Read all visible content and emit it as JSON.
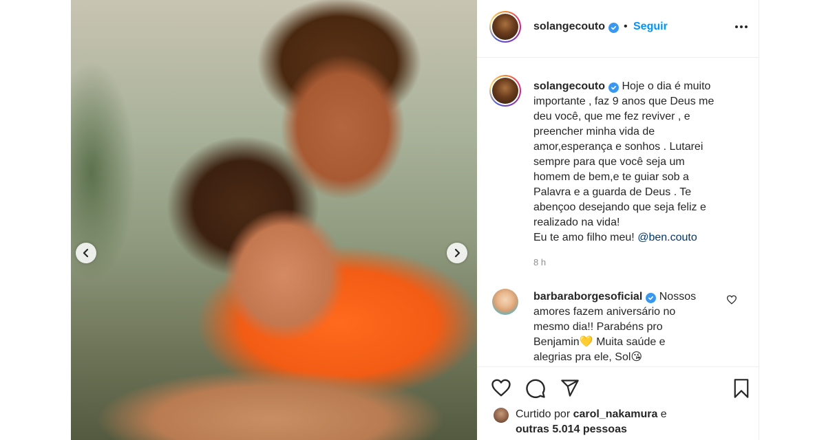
{
  "post": {
    "username": "solangecouto",
    "dot": "•",
    "follow_label": "Seguir",
    "caption_lines": [
      "Hoje o dia é muito",
      "importante , faz 9 anos que Deus me",
      "deu você, que me fez reviver , e",
      "preencher minha vida de",
      "amor,esperança e sonhos . Lutarei",
      "sempre para que você seja um",
      "homem de bem,e te guiar sob a",
      "Palavra e a guarda de Deus . Te",
      "abençoo desejando que seja feliz e",
      "realizado na vida!"
    ],
    "caption_last_prefix": "Eu te amo filho meu!",
    "caption_mention": "@ben.couto",
    "time": "8 h"
  },
  "comment": {
    "username": "barbaraborgesoficial",
    "text_lines": [
      "Nossos",
      "amores fazem aniversário no",
      "mesmo dia!! Parabéns pro",
      "Benjamin💛 Muita saúde e",
      "alegrias pra ele, Sol😘"
    ]
  },
  "likes": {
    "prefix": "Curtido por",
    "user": "carol_nakamura",
    "conj": "e",
    "others": "outras 5.014 pessoas"
  },
  "colors": {
    "follow": "#0095f6",
    "verified": "#3897f0",
    "mention": "#00376b",
    "time": "#8e8e8e"
  },
  "icons": [
    "chevron-left-icon",
    "chevron-right-icon",
    "more-icon",
    "verified-icon",
    "heart-icon",
    "comment-icon",
    "share-icon",
    "bookmark-icon"
  ]
}
